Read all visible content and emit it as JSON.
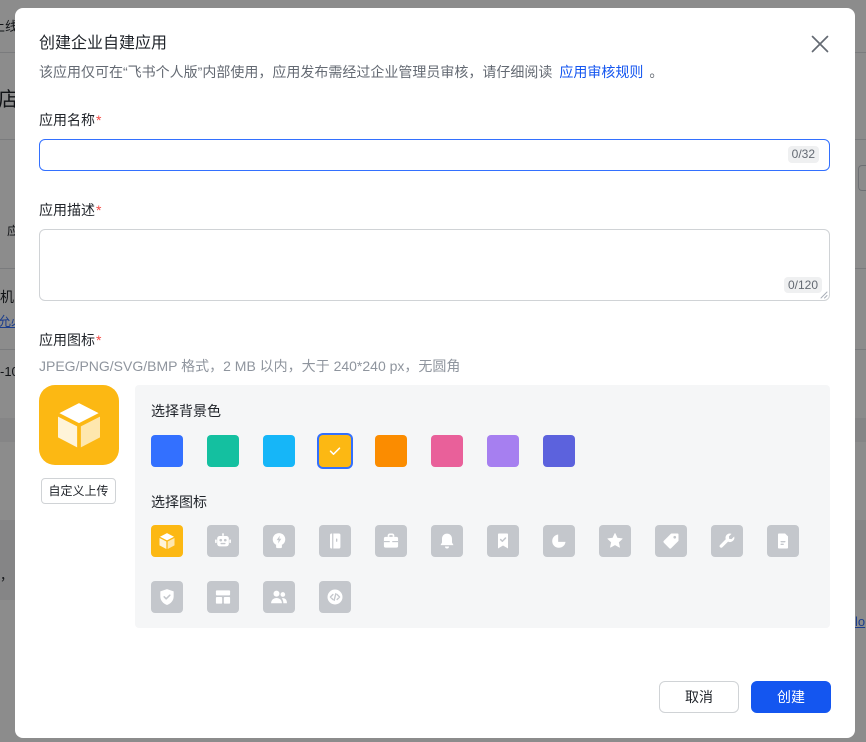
{
  "background_page": {
    "fragments": [
      "上线",
      "店",
      "应",
      "机",
      "允必",
      "-10",
      "，",
      "lo"
    ]
  },
  "dialog": {
    "title": "创建企业自建应用",
    "close_icon": "close-icon",
    "notice": {
      "text": "该应用仅可在“飞书个人版”内部使用，应用发布需经过企业管理员审核，请仔细阅读",
      "link": "应用审核规则",
      "end": "。"
    },
    "name_field": {
      "label": "应用名称",
      "required_mark": "*",
      "value": "",
      "counter": "0/32"
    },
    "description_field": {
      "label": "应用描述",
      "required_mark": "*",
      "value": "",
      "counter": "0/120"
    },
    "icon_field": {
      "label": "应用图标",
      "required_mark": "*",
      "hint": "JPEG/PNG/SVG/BMP 格式，2 MB 以内，大于 240*240 px，无圆角",
      "preview": {
        "icon": "cube-icon",
        "background": "#fcb813"
      },
      "upload_label": "自定义上传",
      "background_color_title": "选择背景色",
      "background_colors": [
        {
          "color": "#3370ff",
          "selected": false
        },
        {
          "color": "#14c0a0",
          "selected": false
        },
        {
          "color": "#16b6f8",
          "selected": false
        },
        {
          "color": "#fcb813",
          "selected": true
        },
        {
          "color": "#fb8c00",
          "selected": false
        },
        {
          "color": "#e9609a",
          "selected": false
        },
        {
          "color": "#a67ff0",
          "selected": false
        },
        {
          "color": "#5c62dd",
          "selected": false
        }
      ],
      "icon_title": "选择图标",
      "icons": [
        {
          "icon": "cube-icon",
          "selected": true
        },
        {
          "icon": "robot-icon",
          "selected": false
        },
        {
          "icon": "lightbulb-icon",
          "selected": false
        },
        {
          "icon": "book-icon",
          "selected": false
        },
        {
          "icon": "briefcase-icon",
          "selected": false
        },
        {
          "icon": "bell-icon",
          "selected": false
        },
        {
          "icon": "bookmark-check-icon",
          "selected": false
        },
        {
          "icon": "pie-chart-icon",
          "selected": false
        },
        {
          "icon": "star-icon",
          "selected": false
        },
        {
          "icon": "tag-icon",
          "selected": false
        },
        {
          "icon": "wrench-icon",
          "selected": false
        },
        {
          "icon": "file-icon",
          "selected": false
        },
        {
          "icon": "shield-check-icon",
          "selected": false
        },
        {
          "icon": "layout-icon",
          "selected": false
        },
        {
          "icon": "users-icon",
          "selected": false
        },
        {
          "icon": "code-icon",
          "selected": false
        }
      ]
    },
    "footer": {
      "cancel_label": "取消",
      "create_label": "创建"
    }
  },
  "colors": {
    "accent": "#3370ff",
    "primary_button": "#1456f0",
    "link": "#1456f0",
    "required_mark": "#f54a45",
    "icon_tile": "#c4c7cc",
    "mask": "rgba(0,0,0,0.45)"
  }
}
